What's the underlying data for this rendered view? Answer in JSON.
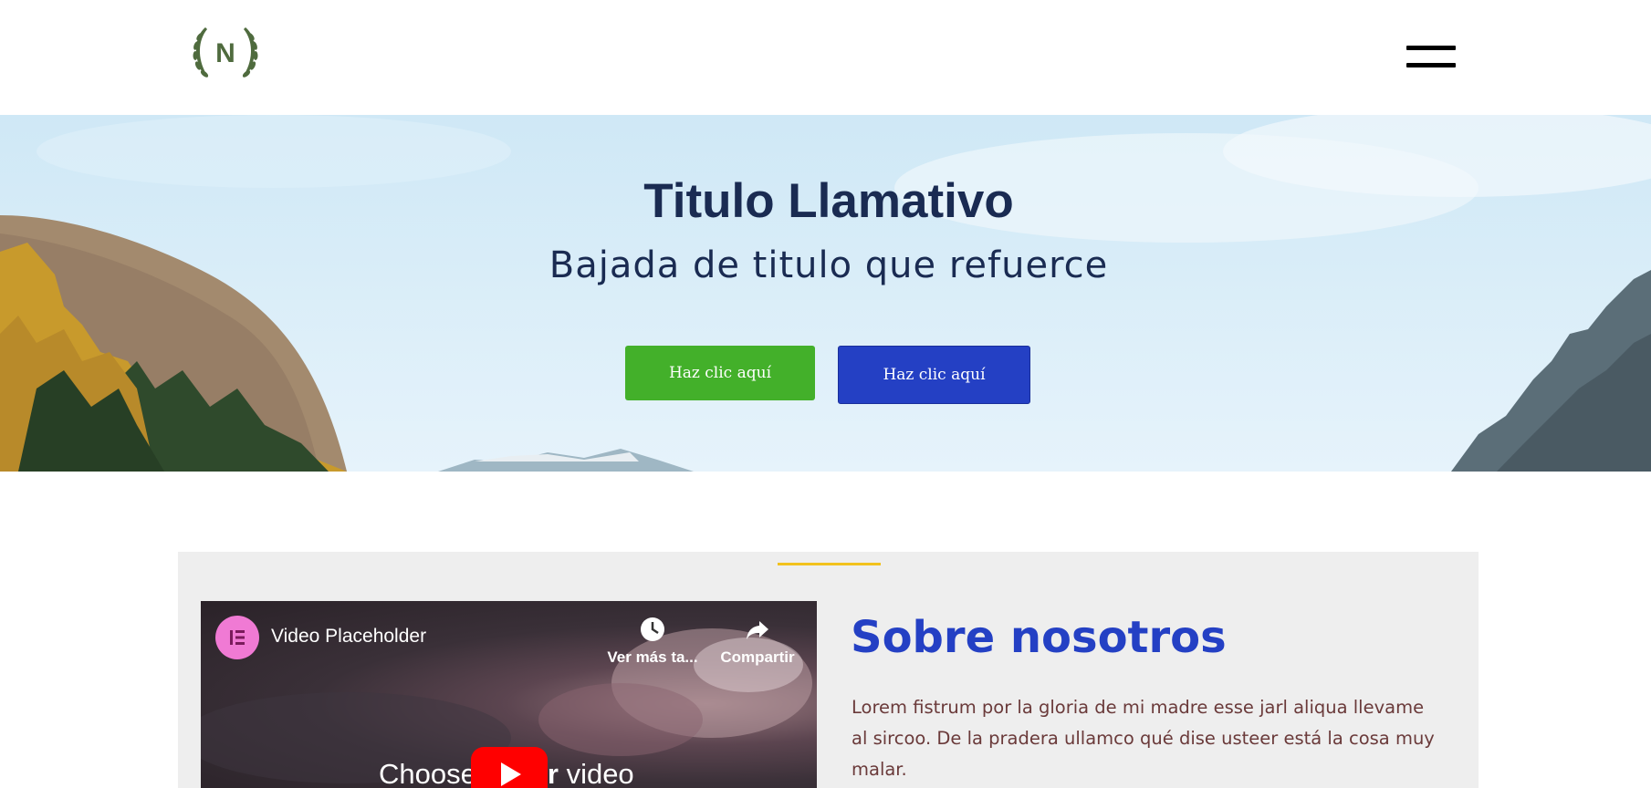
{
  "header": {
    "logo_letter": "N",
    "menu_icon": "hamburger-menu-icon"
  },
  "hero": {
    "title": "Titulo Llamativo",
    "subtitle": "Bajada de titulo que refuerce",
    "button_primary_label": "Haz clic aquí",
    "button_secondary_label": "Haz clic aquí"
  },
  "about": {
    "video": {
      "title": "Video Placeholder",
      "watch_later_label": "Ver más ta...",
      "share_label": "Compartir",
      "overlay_text_left": "Choose",
      "overlay_text_mid": "r",
      "overlay_text_right": "video"
    },
    "title": "Sobre nosotros",
    "body": "Lorem fistrum por la gloria de mi madre esse jarl aliqua llevame al sircoo. De la pradera ullamco qué dise usteer está la cosa muy malar."
  },
  "colors": {
    "accent_blue": "#2440c4",
    "accent_green": "#43b02a",
    "divider_yellow": "#f2c21d",
    "title_navy": "#1a2b52",
    "logo_green": "#4f6b3e"
  }
}
